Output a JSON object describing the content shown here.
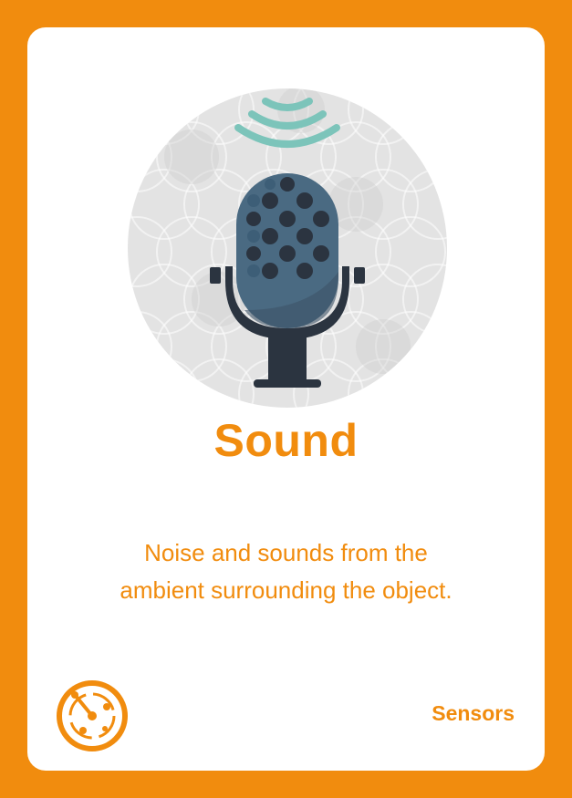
{
  "card": {
    "title": "Sound",
    "description_line1": "Noise and sounds from the",
    "description_line2": "ambient surrounding the object.",
    "category": "Sensors"
  },
  "icons": {
    "illustration": "microphone-icon",
    "category": "sensor-radar-icon"
  },
  "colors": {
    "background": "#F18C0E",
    "card": "#FFFFFF",
    "accent": "#F18C0E",
    "mic_body": "#4A6A82",
    "mic_stand": "#2B3440",
    "sound_waves": "#7CC4BA"
  }
}
